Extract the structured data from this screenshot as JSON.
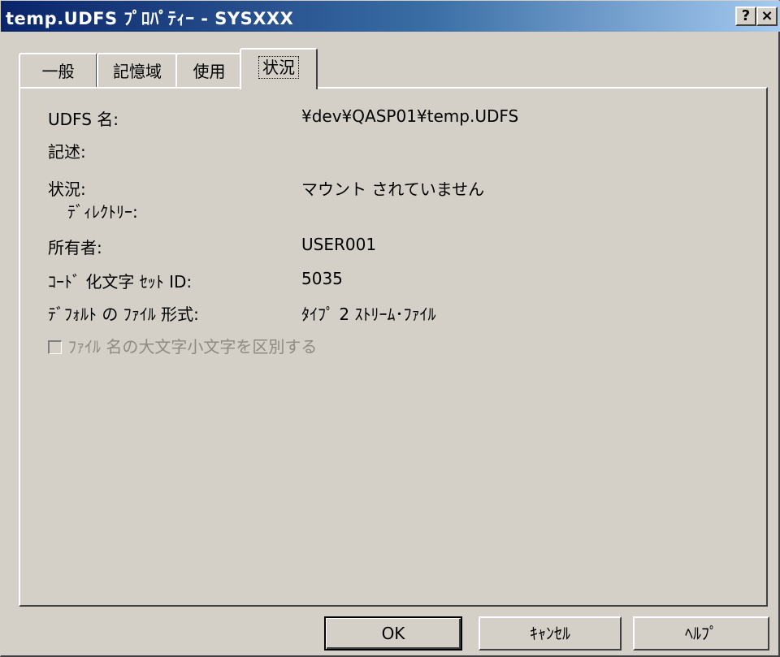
{
  "window": {
    "title": "temp.UDFS ﾌﾟﾛﾊﾟﾃｨｰ - SYSXXX",
    "help_button": "?",
    "close_button": "×"
  },
  "tabs": [
    {
      "label": "一般"
    },
    {
      "label": "記憶域"
    },
    {
      "label": "使用"
    },
    {
      "label": "状況"
    }
  ],
  "active_tab": "状況",
  "fields": {
    "udfs_name_label": "UDFS 名:",
    "udfs_name_value": "¥dev¥QASP01¥temp.UDFS",
    "description_label": "記述:",
    "description_value": "",
    "status_label": "状況:",
    "status_value": "マウント されていません",
    "directory_label": "ﾃﾞｨﾚｸﾄﾘｰ:",
    "directory_value": "",
    "owner_label": "所有者:",
    "owner_value": "USER001",
    "ccsid_label": "ｺｰﾄﾞ 化文字 ｾｯﾄ ID:",
    "ccsid_value": "5035",
    "default_format_label": "ﾃﾞﾌｫﾙﾄ の ﾌｧｲﾙ 形式:",
    "default_format_value": "ﾀｲﾌﾟ 2 ｽﾄﾘｰﾑ･ﾌｧｲﾙ"
  },
  "case_sensitive_checkbox": {
    "label": "ﾌｧｲﾙ 名の大文字小文字を区別する",
    "checked": false,
    "enabled": false
  },
  "buttons": {
    "ok": "OK",
    "cancel": "ｷｬﾝｾﾙ",
    "help": "ﾍﾙﾌﾟ"
  },
  "colors": {
    "title_bar_start": "#0a246a",
    "title_bar_end": "#a6caf0",
    "face": "#d4d0c8",
    "disabled_text": "#8f8a80"
  }
}
